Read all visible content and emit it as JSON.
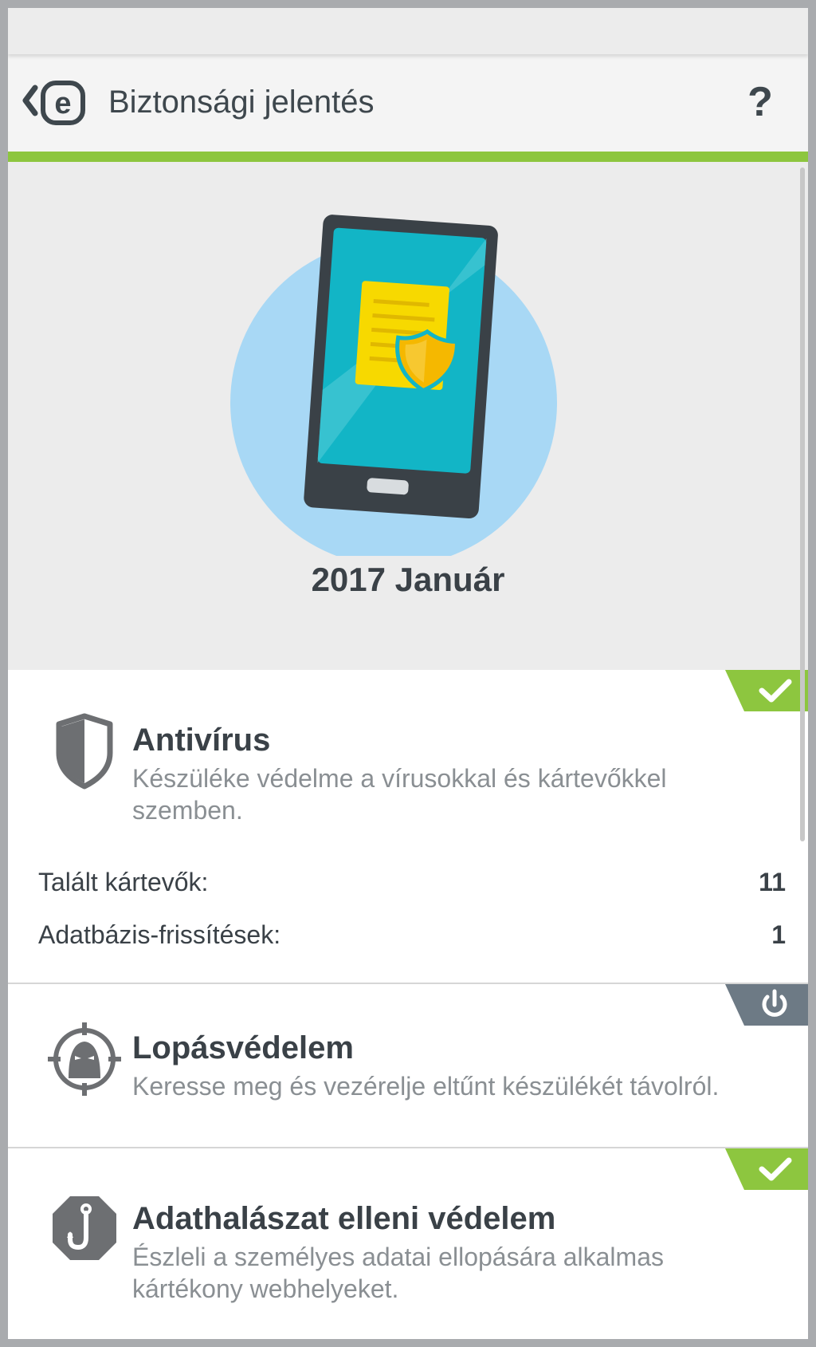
{
  "header": {
    "title": "Biztonsági jelentés",
    "help_label": "?"
  },
  "report": {
    "date": "2017 Január"
  },
  "cards": {
    "antivirus": {
      "title": "Antivírus",
      "description": "Készüléke védelme a vírusokkal és kártevőkkel szemben.",
      "status": "ok",
      "stats": [
        {
          "label": "Talált kártevők:",
          "value": "11"
        },
        {
          "label": "Adatbázis-frissítések:",
          "value": "1"
        }
      ]
    },
    "antitheft": {
      "title": "Lopásvédelem",
      "description": "Keresse meg és vezérelje eltűnt készülékét távolról.",
      "status": "off"
    },
    "phishing": {
      "title": "Adathalászat elleni védelem",
      "description": "Észleli a személyes adatai ellopására alkalmas kártékony webhelyeket.",
      "status": "ok"
    }
  },
  "colors": {
    "accent_green": "#8dc63f",
    "status_off_gray": "#6d7a85",
    "text_dark": "#3a4147",
    "text_muted": "#8a8f93",
    "hero_circle": "#a8d8f5"
  },
  "icons": {
    "back": "chevron-left-icon",
    "logo": "eset-logo",
    "help": "question-mark-icon",
    "antivirus": "shield-icon",
    "antitheft": "thief-target-icon",
    "phishing": "hook-octagon-icon",
    "status_ok": "checkmark-icon",
    "status_off": "power-icon"
  }
}
